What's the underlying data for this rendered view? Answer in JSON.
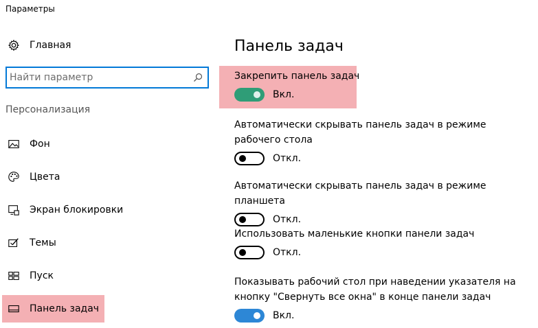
{
  "window": {
    "title": "Параметры"
  },
  "sidebar": {
    "home_label": "Главная",
    "search_placeholder": "Найти параметр",
    "section_label": "Персонализация",
    "items": [
      {
        "label": "Фон",
        "icon": "image-icon"
      },
      {
        "label": "Цвета",
        "icon": "palette-icon"
      },
      {
        "label": "Экран блокировки",
        "icon": "lock-screen-icon"
      },
      {
        "label": "Темы",
        "icon": "themes-icon"
      },
      {
        "label": "Пуск",
        "icon": "start-icon"
      },
      {
        "label": "Панель задач",
        "icon": "taskbar-icon",
        "selected": true
      }
    ]
  },
  "main": {
    "title": "Панель задач",
    "settings": [
      {
        "label": "Закрепить панель задач",
        "state": "Вкл.",
        "on": true
      },
      {
        "label": "Автоматически скрывать панель задач в режиме рабочего стола",
        "state": "Откл.",
        "on": false
      },
      {
        "label": "Автоматически скрывать панель задач в режиме планшета",
        "state": "Откл.",
        "on": false
      },
      {
        "label": "Использовать маленькие кнопки панели задач",
        "state": "Откл.",
        "on": false
      },
      {
        "label": "Показывать рабочий стол при наведении указателя на кнопку \"Свернуть все окна\" в конце панели задач",
        "state": "Вкл.",
        "on": true
      }
    ]
  },
  "colors": {
    "accent": "#0078d7",
    "highlight": "#f4b0b4",
    "toggle_on_green": "#2f9d77",
    "toggle_on_blue": "#2d87d6"
  }
}
